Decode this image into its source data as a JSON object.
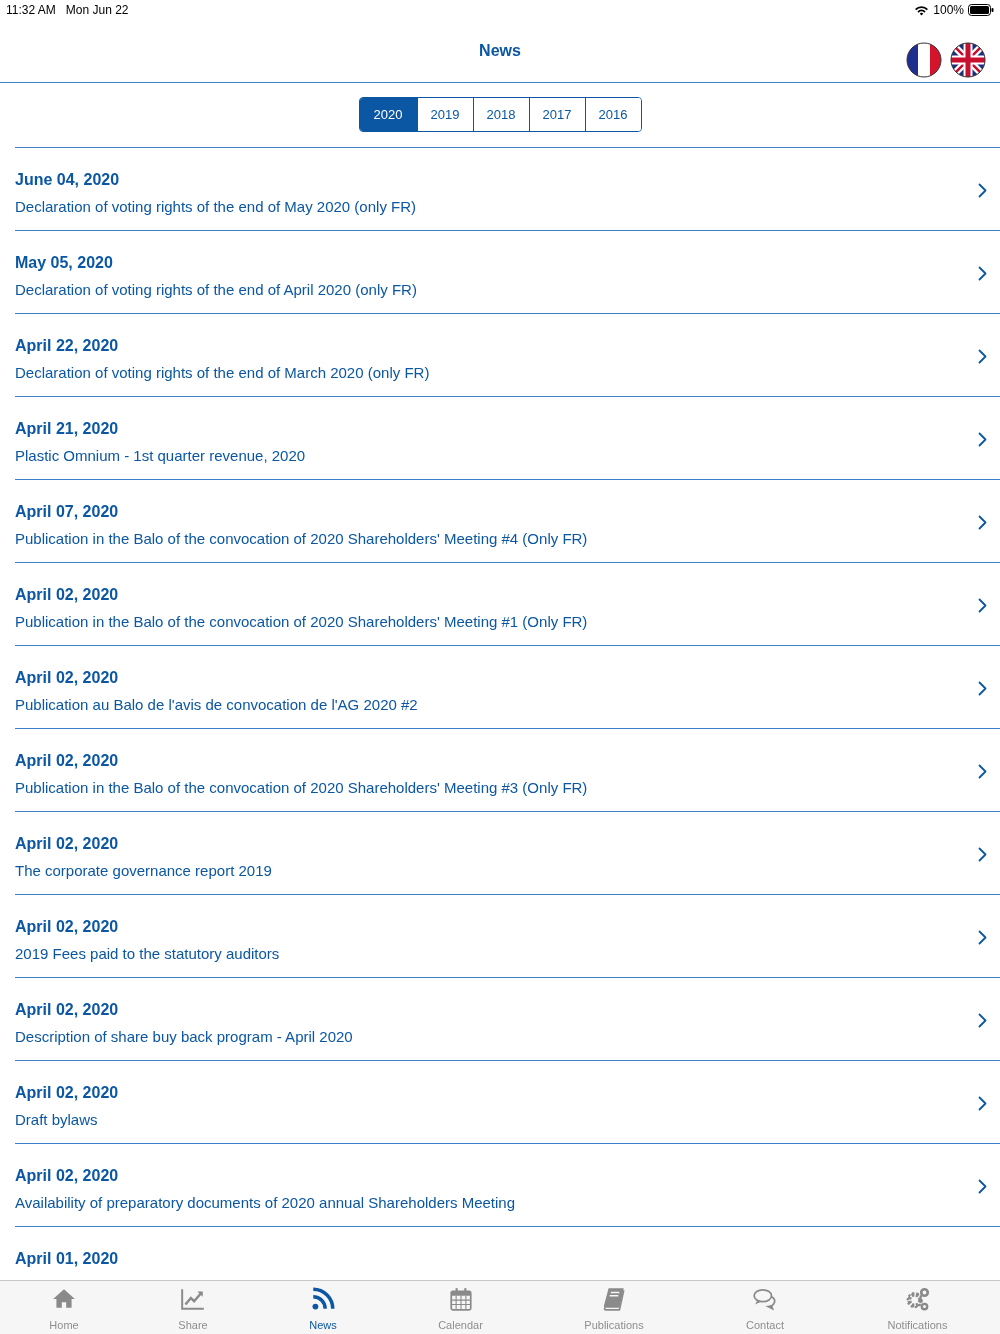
{
  "status_bar": {
    "time": "11:32 AM",
    "date": "Mon Jun 22",
    "battery": "100%"
  },
  "header": {
    "title": "News"
  },
  "years": [
    {
      "label": "2020",
      "selected": true
    },
    {
      "label": "2019",
      "selected": false
    },
    {
      "label": "2018",
      "selected": false
    },
    {
      "label": "2017",
      "selected": false
    },
    {
      "label": "2016",
      "selected": false
    }
  ],
  "news": [
    {
      "date": "June 04, 2020",
      "title": "Declaration of voting rights of the end of May 2020 (only FR)"
    },
    {
      "date": "May 05, 2020",
      "title": "Declaration of voting rights of the end of April 2020 (only FR)"
    },
    {
      "date": "April 22, 2020",
      "title": "Declaration of voting rights of the end of March 2020 (only FR)"
    },
    {
      "date": "April 21, 2020",
      "title": "Plastic Omnium - 1st quarter revenue, 2020"
    },
    {
      "date": "April 07, 2020",
      "title": "Publication in the Balo of the convocation of 2020 Shareholders' Meeting #4 (Only FR)"
    },
    {
      "date": "April 02, 2020",
      "title": "Publication in the Balo of the convocation of 2020 Shareholders' Meeting #1 (Only FR)"
    },
    {
      "date": "April 02, 2020",
      "title": "Publication au Balo de l'avis de convocation de l'AG 2020 #2"
    },
    {
      "date": "April 02, 2020",
      "title": "Publication in the Balo of the convocation of 2020 Shareholders' Meeting #3 (Only FR)"
    },
    {
      "date": "April 02, 2020",
      "title": "The corporate governance report 2019"
    },
    {
      "date": "April 02, 2020",
      "title": "2019 Fees paid to the statutory auditors"
    },
    {
      "date": "April 02, 2020",
      "title": "Description of share buy back program - April 2020"
    },
    {
      "date": "April 02, 2020",
      "title": "Draft bylaws"
    },
    {
      "date": "April 02, 2020",
      "title": "Availability of preparatory documents of 2020 annual Shareholders Meeting"
    },
    {
      "date": "April 01, 2020"
    }
  ],
  "tab_bar": [
    {
      "label": "Home",
      "selected": false
    },
    {
      "label": "Share",
      "selected": false
    },
    {
      "label": "News",
      "selected": true
    },
    {
      "label": "Calendar",
      "selected": false
    },
    {
      "label": "Publications",
      "selected": false
    },
    {
      "label": "Contact",
      "selected": false
    },
    {
      "label": "Notifications",
      "selected": false
    }
  ]
}
